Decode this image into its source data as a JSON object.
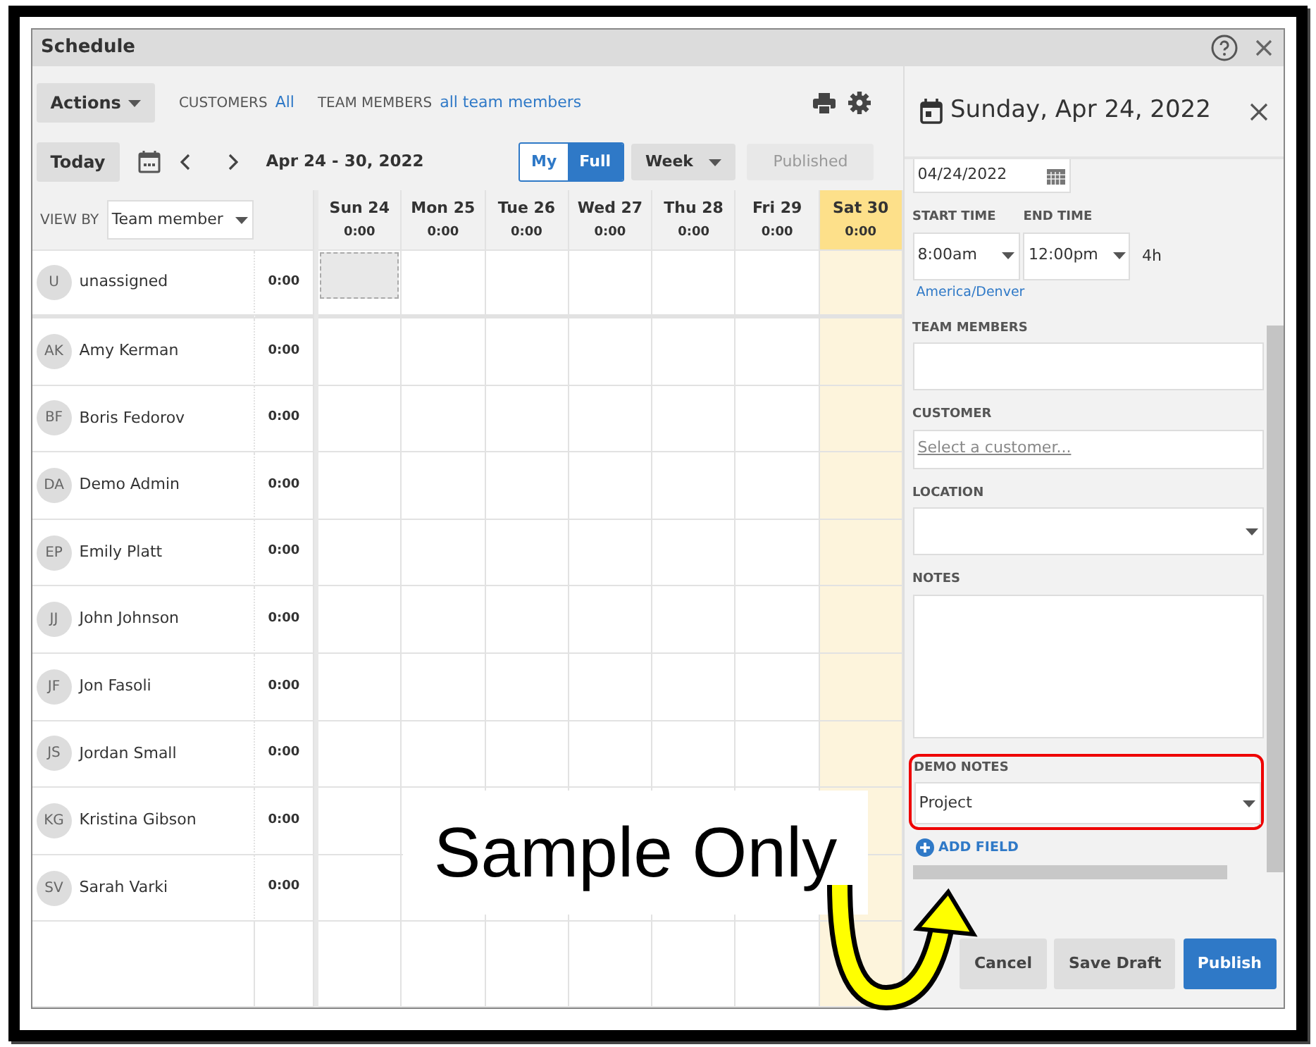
{
  "window": {
    "title": "Schedule"
  },
  "toolbar": {
    "actions": "Actions",
    "filters": [
      {
        "label": "CUSTOMERS",
        "value": "All"
      },
      {
        "label": "TEAM MEMBERS",
        "value": "all team members"
      }
    ]
  },
  "nav": {
    "today": "Today",
    "range": "Apr 24 - 30, 2022",
    "views": [
      {
        "label": "My",
        "selected": false
      },
      {
        "label": "Full",
        "selected": true
      }
    ],
    "period": "Week",
    "published": {
      "label": "Published",
      "disabled": true
    }
  },
  "view_by": {
    "label": "VIEW BY",
    "value": "Team member"
  },
  "days": [
    {
      "label": "Sun 24",
      "total": "0:00",
      "today": false
    },
    {
      "label": "Mon 25",
      "total": "0:00",
      "today": false
    },
    {
      "label": "Tue 26",
      "total": "0:00",
      "today": false
    },
    {
      "label": "Wed 27",
      "total": "0:00",
      "today": false
    },
    {
      "label": "Thu 28",
      "total": "0:00",
      "today": false
    },
    {
      "label": "Fri 29",
      "total": "0:00",
      "today": false
    },
    {
      "label": "Sat 30",
      "total": "0:00",
      "today": true
    }
  ],
  "rows": [
    {
      "kind": "unassigned",
      "initials": "U",
      "name": "unassigned",
      "total": "0:00",
      "slots": [
        {
          "selected": true
        },
        {
          "selected": false
        },
        {
          "selected": false
        },
        {
          "selected": false
        },
        {
          "selected": false
        },
        {
          "selected": false
        },
        {
          "selected": false
        }
      ]
    },
    {
      "kind": "member",
      "initials": "AK",
      "name": "Amy Kerman",
      "total": "0:00"
    },
    {
      "kind": "member",
      "initials": "BF",
      "name": "Boris Fedorov",
      "total": "0:00"
    },
    {
      "kind": "member",
      "initials": "DA",
      "name": "Demo Admin",
      "total": "0:00"
    },
    {
      "kind": "member",
      "initials": "EP",
      "name": "Emily Platt",
      "total": "0:00"
    },
    {
      "kind": "member",
      "initials": "JJ",
      "name": "John Johnson",
      "total": "0:00"
    },
    {
      "kind": "member",
      "initials": "JF",
      "name": "Jon Fasoli",
      "total": "0:00"
    },
    {
      "kind": "member",
      "initials": "JS",
      "name": "Jordan Small",
      "total": "0:00"
    },
    {
      "kind": "member",
      "initials": "KG",
      "name": "Kristina Gibson",
      "total": "0:00"
    },
    {
      "kind": "member",
      "initials": "SV",
      "name": "Sarah Varki",
      "total": "0:00"
    }
  ],
  "panel": {
    "title": "Sunday, Apr 24, 2022",
    "date": "04/24/2022",
    "start_label": "START TIME",
    "start": "8:00am",
    "end_label": "END TIME",
    "end": "12:00pm",
    "duration": "4h",
    "timezone": "America/Denver",
    "fields": [
      {
        "kind": "text",
        "label": "TEAM MEMBERS",
        "highlighted": false
      },
      {
        "kind": "link",
        "label": "CUSTOMER",
        "placeholder": "Select a customer...",
        "highlighted": false
      },
      {
        "kind": "select",
        "label": "LOCATION",
        "highlighted": false
      },
      {
        "kind": "textarea",
        "label": "NOTES",
        "highlighted": false
      },
      {
        "kind": "select",
        "label": "DEMO NOTES",
        "value": "Project",
        "highlighted": true
      }
    ],
    "add_field": "ADD FIELD",
    "buttons": [
      {
        "label": "Cancel",
        "primary": false
      },
      {
        "label": "Save Draft",
        "primary": false
      },
      {
        "label": "Publish",
        "primary": true
      }
    ]
  },
  "annotation": {
    "text": "Sample Only"
  }
}
